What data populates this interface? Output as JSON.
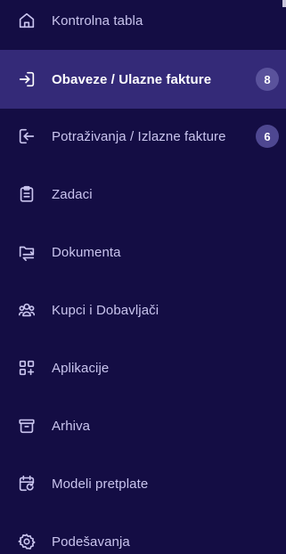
{
  "sidebar": {
    "items": [
      {
        "label": "Kontrolna tabla",
        "icon": "home-icon"
      },
      {
        "label": "Obaveze / Ulazne fakture",
        "icon": "login-icon",
        "badge": "8",
        "active": true
      },
      {
        "label": "Potraživanja / Izlazne fakture",
        "icon": "logout-icon",
        "badge": "6"
      },
      {
        "label": "Zadaci",
        "icon": "clipboard-icon"
      },
      {
        "label": "Dokumenta",
        "icon": "folder-transfer-icon"
      },
      {
        "label": "Kupci i Dobavljači",
        "icon": "users-icon"
      },
      {
        "label": "Aplikacije",
        "icon": "apps-add-icon"
      },
      {
        "label": "Arhiva",
        "icon": "archive-icon"
      },
      {
        "label": "Modeli pretplate",
        "icon": "calendar-repeat-icon"
      },
      {
        "label": "Podešavanja",
        "icon": "gear-icon"
      }
    ]
  },
  "colors": {
    "background": "#140d44",
    "active_background": "#342a78",
    "text": "#c9c4ee",
    "badge": "#4e4791"
  }
}
